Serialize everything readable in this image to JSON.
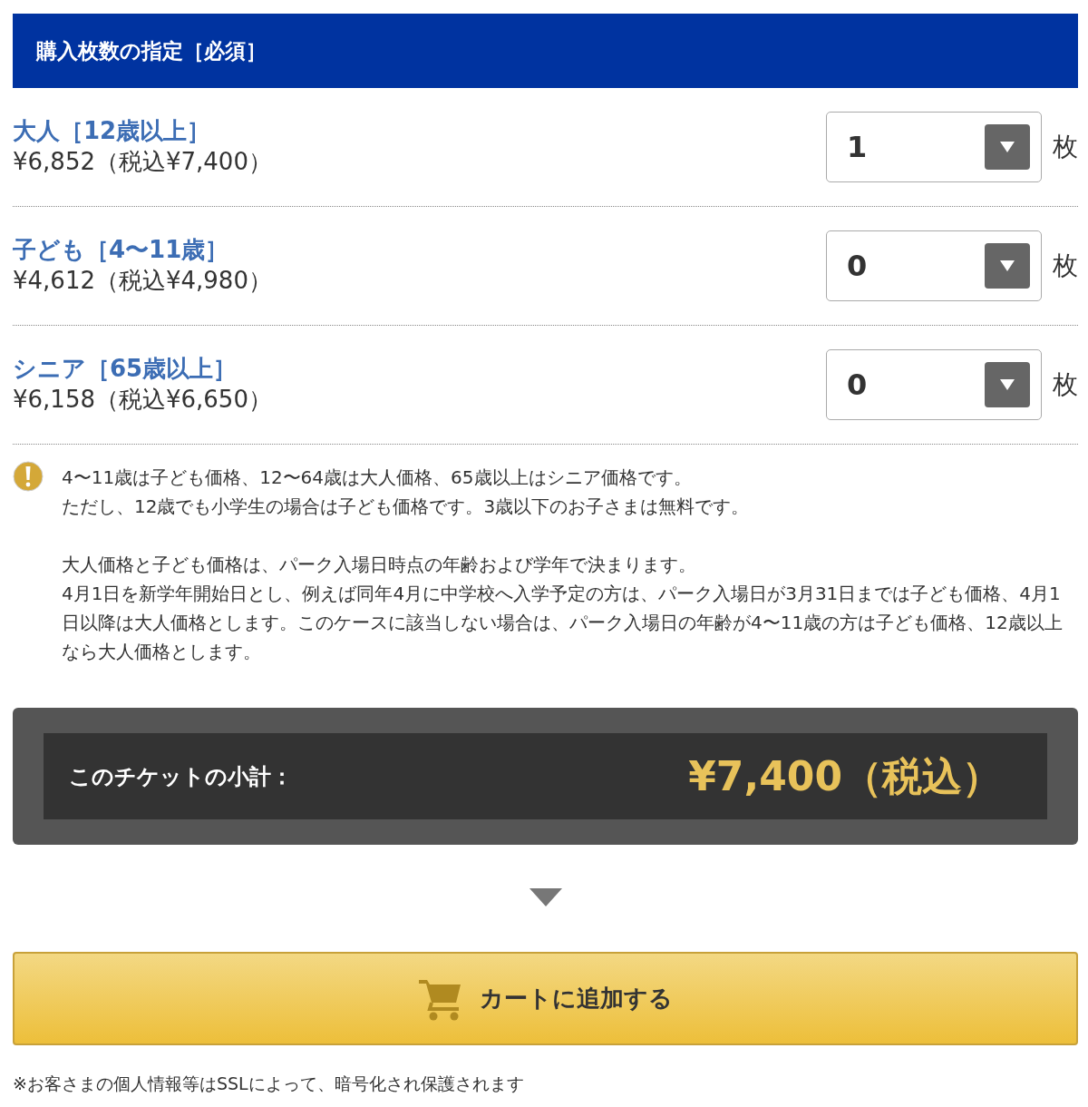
{
  "header": {
    "title": "購入枚数の指定［必須］"
  },
  "tickets": [
    {
      "name": "大人［12歳以上］",
      "price": "¥6,852（税込¥7,400）",
      "quantity": "1",
      "unit": "枚"
    },
    {
      "name": "子ども［4〜11歳］",
      "price": "¥4,612（税込¥4,980）",
      "quantity": "0",
      "unit": "枚"
    },
    {
      "name": "シニア［65歳以上］",
      "price": "¥6,158（税込¥6,650）",
      "quantity": "0",
      "unit": "枚"
    }
  ],
  "notes": [
    [
      "4〜11歳は子ども価格、12〜64歳は大人価格、65歳以上はシニア価格です。",
      "ただし、12歳でも小学生の場合は子ども価格です。3歳以下のお子さまは無料です。"
    ],
    [
      "大人価格と子ども価格は、パーク入場日時点の年齢および学年で決まります。",
      "4月1日を新学年開始日とし、例えば同年4月に中学校へ入学予定の方は、パーク入場日が3月31日までは子ども価格、4月1日以降は大人価格とします。このケースに該当しない場合は、パーク入場日の年齢が4〜11歳の方は子ども価格、12歳以上なら大人価格とします。"
    ]
  ],
  "subtotal": {
    "label": "このチケットの小計：",
    "amount": "¥7,400（税込）"
  },
  "cart_button": {
    "label": "カートに追加する"
  },
  "footer_note": "※お客さまの個人情報等はSSLによって、暗号化され保護されます"
}
